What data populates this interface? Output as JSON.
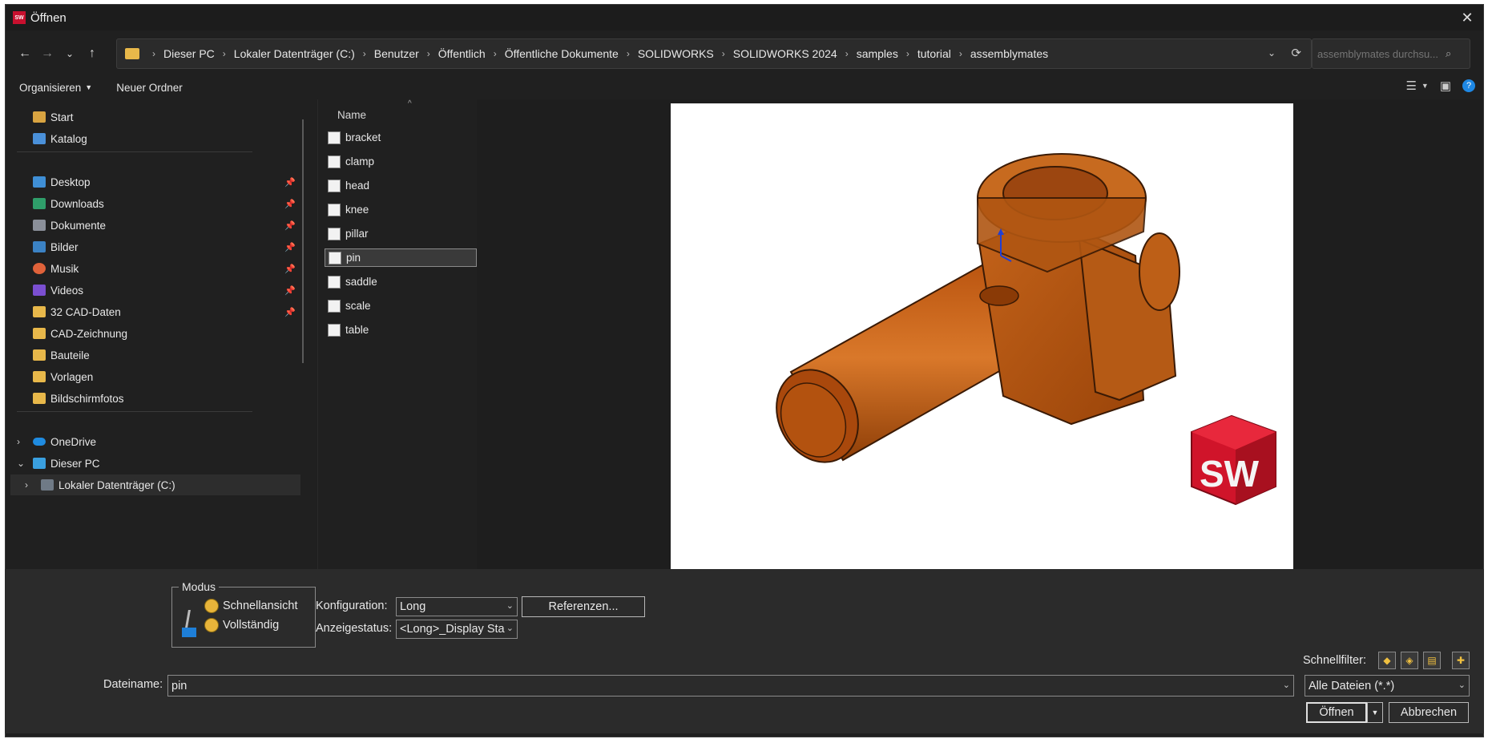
{
  "window": {
    "title": "Öffnen",
    "app_icon_text": "SW"
  },
  "address": {
    "crumbs": [
      "Dieser PC",
      "Lokaler Datenträger (C:)",
      "Benutzer",
      "Öffentlich",
      "Öffentliche Dokumente",
      "SOLIDWORKS",
      "SOLIDWORKS 2024",
      "samples",
      "tutorial",
      "assemblymates"
    ]
  },
  "search": {
    "placeholder": "assemblymates durchsu..."
  },
  "toolbar": {
    "organize": "Organisieren",
    "new_folder": "Neuer Ordner"
  },
  "sidebar": {
    "quick": [
      {
        "label": "Start"
      },
      {
        "label": "Katalog"
      }
    ],
    "pinned": [
      {
        "label": "Desktop"
      },
      {
        "label": "Downloads"
      },
      {
        "label": "Dokumente"
      },
      {
        "label": "Bilder"
      },
      {
        "label": "Musik"
      },
      {
        "label": "Videos"
      },
      {
        "label": "32 CAD-Daten"
      },
      {
        "label": "CAD-Zeichnung"
      },
      {
        "label": "Bauteile"
      },
      {
        "label": "Vorlagen"
      },
      {
        "label": "Bildschirmfotos"
      }
    ],
    "tree": [
      {
        "label": "OneDrive"
      },
      {
        "label": "Dieser PC"
      },
      {
        "label": "Lokaler Datenträger (C:)"
      }
    ]
  },
  "filelist": {
    "header": "Name",
    "files": [
      "bracket",
      "clamp",
      "head",
      "knee",
      "pillar",
      "pin",
      "saddle",
      "scale",
      "table"
    ],
    "selected": "pin"
  },
  "bottom": {
    "modus_legend": "Modus",
    "modus_options": [
      "Schnellansicht",
      "Vollständig"
    ],
    "config_label": "Konfiguration:",
    "config_value": "Long",
    "display_label": "Anzeigestatus:",
    "display_value": "<Long>_Display Sta",
    "references_button": "Referenzen...",
    "quickfilter_label": "Schnellfilter:",
    "filename_label": "Dateiname:",
    "filename_value": "pin",
    "filetype_value": "Alle Dateien (*.*)",
    "open_button": "Öffnen",
    "cancel_button": "Abbrechen"
  },
  "preview_logo_text": "SW"
}
